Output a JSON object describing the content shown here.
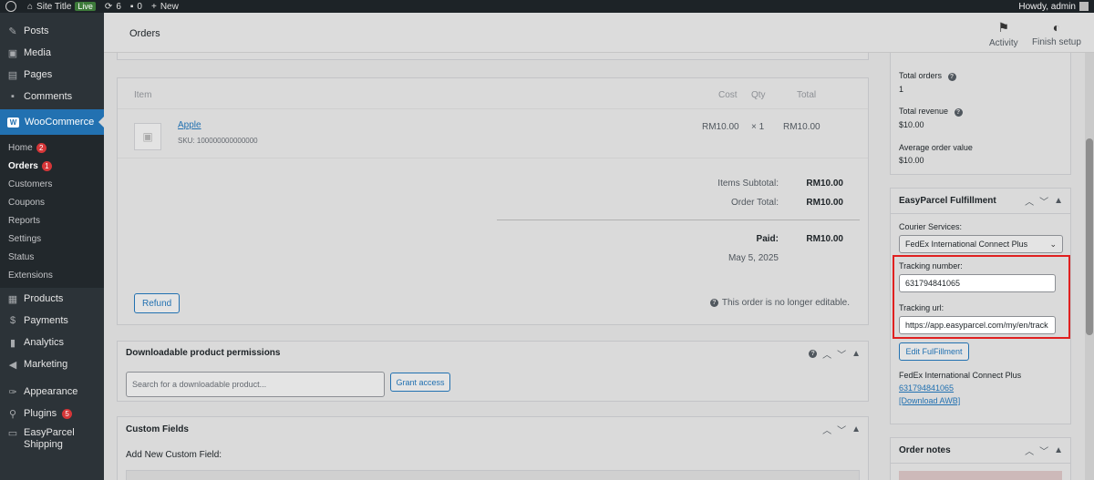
{
  "adminbar": {
    "site_title": "Site Title",
    "live": "Live",
    "updates_count": "6",
    "comments_count": "0",
    "new_label": "New",
    "howdy": "Howdy, admin"
  },
  "sidebar": {
    "items_top": [
      {
        "label": "Posts",
        "icon": "pin-icon"
      },
      {
        "label": "Media",
        "icon": "media-icon"
      },
      {
        "label": "Pages",
        "icon": "pages-icon"
      },
      {
        "label": "Comments",
        "icon": "comments-icon"
      }
    ],
    "woocommerce": "WooCommerce",
    "submenu": [
      {
        "label": "Home",
        "badge": "2"
      },
      {
        "label": "Orders",
        "badge": "1"
      },
      {
        "label": "Customers"
      },
      {
        "label": "Coupons"
      },
      {
        "label": "Reports"
      },
      {
        "label": "Settings"
      },
      {
        "label": "Status"
      },
      {
        "label": "Extensions"
      }
    ],
    "items_bottom": [
      {
        "label": "Products",
        "icon": "products-icon"
      },
      {
        "label": "Payments",
        "icon": "payments-icon"
      },
      {
        "label": "Analytics",
        "icon": "analytics-icon"
      },
      {
        "label": "Marketing",
        "icon": "marketing-icon"
      },
      {
        "label": "Appearance",
        "icon": "appearance-icon"
      },
      {
        "label": "Plugins",
        "icon": "plugins-icon",
        "badge": "5"
      },
      {
        "label": "EasyParcel Shipping",
        "icon": "shipping-icon"
      }
    ]
  },
  "header": {
    "title": "Orders",
    "activity": "Activity",
    "finish_setup": "Finish setup"
  },
  "items_panel": {
    "col_item": "Item",
    "col_cost": "Cost",
    "col_qty": "Qty",
    "col_total": "Total",
    "item": {
      "name": "Apple",
      "sku": "SKU: 100000000000000",
      "cost": "RM10.00",
      "qty": "× 1",
      "total": "RM10.00"
    },
    "items_subtotal_label": "Items Subtotal:",
    "items_subtotal": "RM10.00",
    "order_total_label": "Order Total:",
    "order_total": "RM10.00",
    "paid_label": "Paid:",
    "paid": "RM10.00",
    "paid_date": "May 5, 2025",
    "refund": "Refund",
    "not_editable": "This order is no longer editable."
  },
  "downloads_panel": {
    "title": "Downloadable product permissions",
    "search_placeholder": "Search for a downloadable product...",
    "grant": "Grant access"
  },
  "custom_fields_panel": {
    "title": "Custom Fields",
    "add_new": "Add New Custom Field:"
  },
  "customer_stats": {
    "total_orders_label": "Total orders",
    "total_orders": "1",
    "total_revenue_label": "Total revenue",
    "total_revenue": "$10.00",
    "aov_label": "Average order value",
    "aov": "$10.00"
  },
  "fulfillment": {
    "title": "EasyParcel Fulfillment",
    "courier_label": "Courier Services:",
    "courier_value": "FedEx International Connect Plus",
    "tracking_number_label": "Tracking number:",
    "tracking_number": "631794841065",
    "tracking_url_label": "Tracking url:",
    "tracking_url": "https://app.easyparcel.com/my/en/track",
    "edit_button": "Edit FulFillment",
    "summary_courier": "FedEx International Connect Plus",
    "summary_tracking": "631794841065",
    "download_awb": "[Download AWB]"
  },
  "order_notes": {
    "title": "Order notes"
  }
}
